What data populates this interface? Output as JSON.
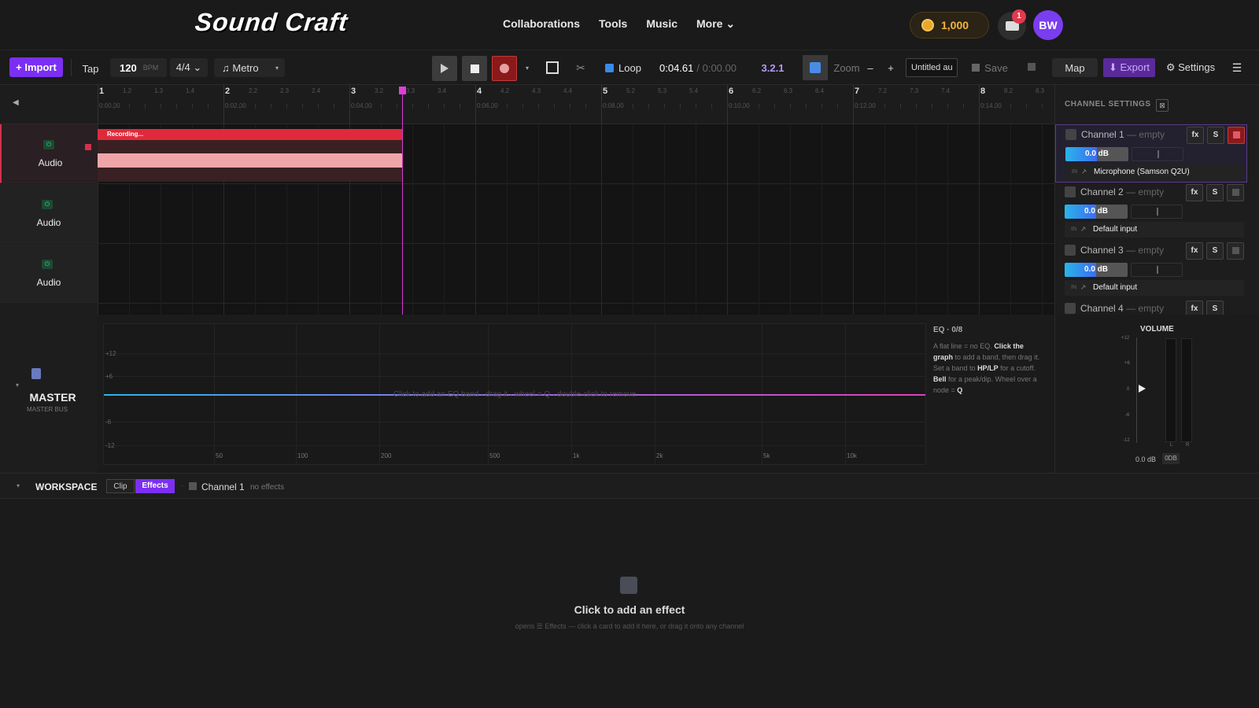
{
  "nav": {
    "logo": "Sound Craft",
    "links": [
      "Collaborations",
      "Tools",
      "Music",
      "More ⌄"
    ],
    "coins": "1,000",
    "notifications": "1",
    "avatar": "BW"
  },
  "toolbar": {
    "import": "+ Import",
    "tap": "Tap",
    "bpm": "120",
    "bpm_unit": "BPM",
    "time_sig": "4/4 ⌄",
    "metro": "♫ Metro",
    "loop": "Loop",
    "time_current": "0:04.61",
    "time_total": "/ 0:00.00",
    "position": "3.2.1",
    "zoom": "Zoom",
    "zoom_minus": "–",
    "zoom_plus": "+",
    "project_name": "Untitled au",
    "save": "Save",
    "map": "Map",
    "export": "⬇ Export",
    "settings": "⚙ Settings",
    "menu": "☰",
    "accent": "#7b2ff2"
  },
  "ruler": {
    "bars": [
      "1",
      "2",
      "3",
      "4",
      "5",
      "6",
      "7",
      "8"
    ],
    "subs": [
      [
        "1.2",
        "1.3",
        "1.4"
      ],
      [
        "2.2",
        "2.3",
        "2.4"
      ],
      [
        "3.2",
        "3.3",
        "3.4"
      ],
      [
        "4.2",
        "4.3",
        "4.4"
      ],
      [
        "5.2",
        "5.3",
        "5.4"
      ],
      [
        "6.2",
        "6.3",
        "6.4"
      ],
      [
        "7.2",
        "7.3",
        "7.4"
      ],
      [
        "8.2",
        "8.3"
      ]
    ],
    "times": [
      "0:00.00",
      "0:02.00",
      "0:04.00",
      "0:06.00",
      "0:08.00",
      "0:10.00",
      "0:12.00",
      "0:14.00"
    ],
    "collapse": "◀"
  },
  "tracks": [
    {
      "name": "Audio"
    },
    {
      "name": "Audio"
    },
    {
      "name": "Audio"
    }
  ],
  "clip": {
    "label": "Recording..."
  },
  "channel_settings": {
    "title": "CHANNEL SETTINGS",
    "channels": [
      {
        "name": "Channel 1",
        "state": "— empty",
        "db": "0.0 dB",
        "in": "IN",
        "input": "Microphone (Samson Q2U)"
      },
      {
        "name": "Channel 2",
        "state": "— empty",
        "db": "0.0 dB",
        "in": "IN",
        "input": "Default input"
      },
      {
        "name": "Channel 3",
        "state": "— empty",
        "db": "0.0 dB",
        "in": "IN",
        "input": "Default input"
      },
      {
        "name": "Channel 4",
        "state": "— empty",
        "db": "",
        "in": "",
        "input": ""
      }
    ],
    "fx": "fx",
    "solo": "S"
  },
  "master": {
    "name": "MASTER",
    "sub": "MASTER BUS"
  },
  "eq": {
    "x_ticks": [
      "50",
      "100",
      "200",
      "500",
      "1k",
      "2k",
      "5k",
      "10k"
    ],
    "y_ticks": [
      "+12",
      "+6",
      "-6",
      "-12"
    ],
    "hint": "Click to add an EQ band · drag it · wheel = Q · double-click to remove",
    "info_title": "EQ · 0/8",
    "info_1": "A flat line = no EQ.",
    "info_2": "Click the graph",
    "info_3": "to add a band, then drag it. Set a band to",
    "info_4": "HP/LP",
    "info_5": "for a cutoff.",
    "info_6": "Bell",
    "info_7": "for a peak/dip. Wheel over a node =",
    "info_8": "Q"
  },
  "volume": {
    "title": "VOLUME",
    "scale": [
      "+12",
      "+6",
      "0",
      "-6",
      "-12"
    ],
    "value": "0.0 dB",
    "btn": "0DB",
    "l": "L",
    "r": "R"
  },
  "workspace": {
    "title": "WORKSPACE",
    "tab_clip": "Clip",
    "tab_effects": "Effects",
    "channel": "Channel 1",
    "status": "no effects"
  },
  "empty": {
    "title": "Click to add an effect",
    "sub": "opens ☰ Effects — click a card to add it here, or drag it onto any channel"
  }
}
